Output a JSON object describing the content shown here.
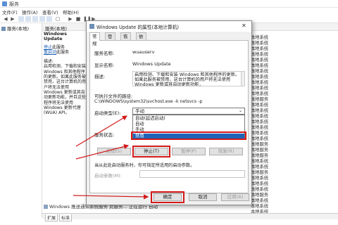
{
  "window": {
    "title": "服务"
  },
  "menu": [
    "文件(F)",
    "操作(A)",
    "查看(V)",
    "帮助(H)"
  ],
  "tree": {
    "item": "服务(本地)"
  },
  "header": {
    "title": "服务(本地)"
  },
  "desc_panel": {
    "service_name": "Windows Update",
    "stop_link": "停止",
    "stop_suffix": "此服务",
    "restart_link": "重启动",
    "restart_suffix": "此服务",
    "label": "描述:",
    "text": "启用检测、下载和安装 Windows 和其他程序的更新。如果此服务被禁用，这台计算机的用户将无法使用 Windows 更新或其自动更新功能，并且这些程序将无法使用 Windows 更新代理(WUA) API。"
  },
  "right_column": [
    "本地系统",
    "本地系统",
    "本地系统",
    "本地系统",
    "本地系统",
    "本地系统",
    "本地系统",
    "本地系统",
    "本地系统",
    "本地系统",
    "本地系统",
    "本地服务",
    "本地系统",
    "本地系统",
    "本地系统",
    "本地系统",
    "本地系统",
    "本地系统",
    "本地系统",
    "本地服务",
    "本地服务",
    "本地服务",
    "本地系统",
    "本地系统",
    "本地服务",
    "本地系统",
    "本地系统",
    "本地系统",
    "本地服务",
    "本地系统",
    "本地系统",
    "本地系统"
  ],
  "background_row": "Windows 推送通知系统服务  此服务...  正在运行  自动",
  "bottom_tabs": [
    "扩展",
    "标准"
  ],
  "dialog": {
    "title": "Windows Update 的属性(本地计算机)",
    "tabs": [
      "常规",
      "登录",
      "恢复",
      "依存关系"
    ],
    "service_name_label": "服务名称:",
    "service_name": "wuauserv",
    "display_name_label": "显示名称:",
    "display_name": "Windows Update",
    "desc_label": "描述:",
    "desc": "启用检测、下载和安装 Windows 和其他程序的更新。如果此服务被禁用，这台计算机的用户将无法使用 Windows 更新或其自动更新功能，",
    "path_label": "可执行文件的路径:",
    "path": "C:\\WINDOWS\\system32\\svchost.exe -k netsvcs -p",
    "startup_label": "启动类型(E):",
    "startup_value": "手动",
    "startup_options": [
      "自动(延迟启动)",
      "自动",
      "手动",
      "禁用"
    ],
    "selected_option": "禁用",
    "status_label": "服务状态:",
    "buttons": {
      "start": "启动(S)",
      "stop": "停止(T)",
      "pause": "暂停(P)",
      "resume": "恢复(R)"
    },
    "hint": "当从此处启动服务时，你可指定所适用的启动参数。",
    "params_label": "启动参数(M):",
    "ok": "确定",
    "cancel": "取消",
    "apply": "应用(A)"
  },
  "colors": {
    "accent": "#1e63b8",
    "highlight": "#d31919"
  }
}
